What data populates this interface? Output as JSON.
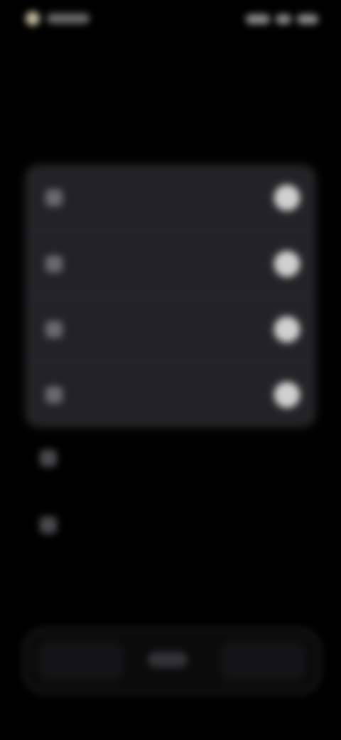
{
  "status_bar": {
    "time": "",
    "indicator_color": "#f1e7c3"
  },
  "header": {
    "title": "",
    "subtitle": ""
  },
  "settings_card": {
    "rows": [
      {
        "label": "",
        "icon": "app-icon",
        "toggle_on": true
      },
      {
        "label": "",
        "icon": "app-icon",
        "toggle_on": true
      },
      {
        "label": "",
        "icon": "app-icon",
        "toggle_on": true
      },
      {
        "label": "",
        "icon": "app-icon",
        "toggle_on": true
      }
    ]
  },
  "extra_rows": [
    {
      "label": "",
      "icon": "app-icon"
    },
    {
      "label": "",
      "icon": "app-icon"
    }
  ],
  "bottom_bar": {
    "label": ""
  },
  "colors": {
    "background": "#000000",
    "card": "#232326",
    "toggle": "#d0d0d0"
  }
}
